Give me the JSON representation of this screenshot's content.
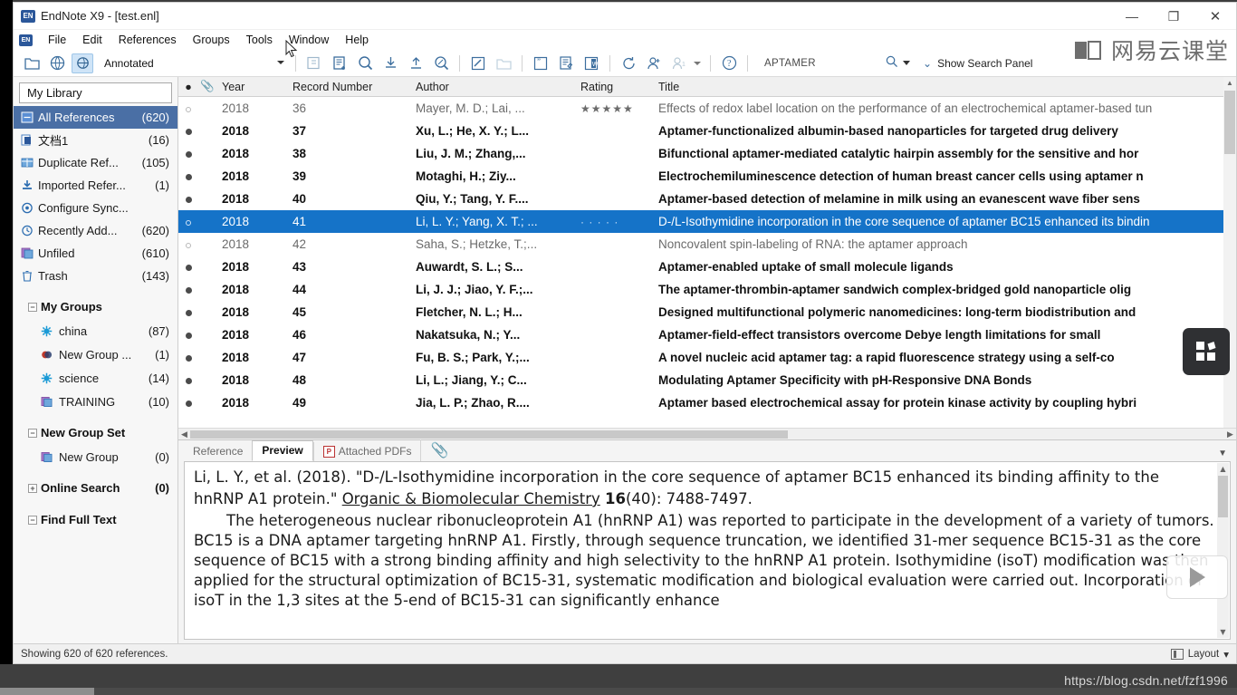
{
  "window": {
    "title": "EndNote X9 - [test.enl]",
    "app_icon": "EN",
    "minimize": "—",
    "maximize": "❐",
    "close": "✕"
  },
  "menu": {
    "items": [
      "File",
      "Edit",
      "References",
      "Groups",
      "Tools",
      "Window",
      "Help"
    ]
  },
  "toolbar": {
    "style": "Annotated",
    "icons": [
      "new-library-icon",
      "online-search-icon",
      "sync-library-icon",
      "new-reference-icon",
      "edit-reference-icon",
      "online-search-mode-icon",
      "import-icon",
      "export-icon",
      "find-full-text-icon",
      "open-pdf-icon",
      "open-file-folder-icon",
      "insert-citation-icon",
      "format-bibliography-icon",
      "word-cwyw-icon",
      "sync-icon",
      "share-library-icon",
      "activity-feed-icon",
      "help-icon"
    ],
    "search_value": "APTAMER",
    "search_placeholder": "Search",
    "show_search_panel": "Show Search Panel"
  },
  "brand": {
    "text": "网易云课堂"
  },
  "sidebar": {
    "library_label": "My Library",
    "groups": [
      {
        "icon": "all-references-icon",
        "label": "All References",
        "count": "(620)",
        "selected": true
      },
      {
        "icon": "document-group-icon",
        "label": "文档1",
        "count": "(16)",
        "selected": false
      },
      {
        "icon": "duplicate-references-icon",
        "label": "Duplicate Ref...",
        "count": "(105)",
        "selected": false
      },
      {
        "icon": "imported-references-icon",
        "label": "Imported Refer...",
        "count": "(1)",
        "selected": false
      },
      {
        "icon": "configure-sync-icon",
        "label": "Configure Sync...",
        "count": "",
        "selected": false
      },
      {
        "icon": "recently-added-icon",
        "label": "Recently Add...",
        "count": "(620)",
        "selected": false
      },
      {
        "icon": "unfiled-icon",
        "label": "Unfiled",
        "count": "(610)",
        "selected": false
      },
      {
        "icon": "trash-icon",
        "label": "Trash",
        "count": "(143)",
        "selected": false
      }
    ],
    "my_groups": {
      "title": "My Groups",
      "expander": "−",
      "items": [
        {
          "icon": "smart-group-icon",
          "label": "china",
          "count": "(87)"
        },
        {
          "icon": "combo-group-icon",
          "label": "New Group ...",
          "count": "(1)"
        },
        {
          "icon": "smart-group-icon",
          "label": "science",
          "count": "(14)"
        },
        {
          "icon": "custom-group-icon",
          "label": "TRAINING",
          "count": "(10)"
        }
      ]
    },
    "new_group_set": {
      "title": "New Group Set",
      "expander": "−",
      "items": [
        {
          "icon": "custom-group-icon",
          "label": "New Group",
          "count": "(0)"
        }
      ]
    },
    "online_search": {
      "title": "Online Search",
      "expander": "+",
      "count": "(0)"
    },
    "find_full_text": {
      "title": "Find Full Text",
      "expander": "−",
      "count": ""
    }
  },
  "table": {
    "columns": {
      "read_status": "●",
      "attachment": "📎",
      "year": "Year",
      "record_number": "Record Number",
      "author": "Author",
      "rating": "Rating",
      "title": "Title"
    },
    "rows": [
      {
        "state": "read",
        "year": "2018",
        "record": "36",
        "author": "Mayer, M. D.; Lai, ...",
        "rating": "★★★★★",
        "title": "Effects of redox label location on the performance of an electrochemical aptamer-based tun"
      },
      {
        "state": "unread",
        "year": "2018",
        "record": "37",
        "author": "Xu, L.; He, X. Y.; L...",
        "rating": "",
        "title": "Aptamer-functionalized albumin-based nanoparticles for targeted drug delivery"
      },
      {
        "state": "unread",
        "year": "2018",
        "record": "38",
        "author": "Liu, J. M.; Zhang,...",
        "rating": "",
        "title": "Bifunctional aptamer-mediated catalytic hairpin assembly for the sensitive and hor"
      },
      {
        "state": "unread",
        "year": "2018",
        "record": "39",
        "author": "Motaghi, H.; Ziy...",
        "rating": "",
        "title": "Electrochemiluminescence detection of human breast cancer cells using aptamer n"
      },
      {
        "state": "unread",
        "year": "2018",
        "record": "40",
        "author": "Qiu, Y.; Tang, Y. F....",
        "rating": "",
        "title": "Aptamer-based detection of melamine in milk using an evanescent wave fiber sens"
      },
      {
        "state": "selected",
        "year": "2018",
        "record": "41",
        "author": "Li, L. Y.; Yang, X. T.; ...",
        "rating": "· · · · ·",
        "title": "D-/L-Isothymidine incorporation in the core sequence of aptamer BC15 enhanced its bindin"
      },
      {
        "state": "read",
        "year": "2018",
        "record": "42",
        "author": "Saha, S.; Hetzke, T.;...",
        "rating": "",
        "title": "Noncovalent spin-labeling of RNA: the aptamer approach"
      },
      {
        "state": "unread",
        "year": "2018",
        "record": "43",
        "author": "Auwardt, S. L.; S...",
        "rating": "",
        "title": "Aptamer-enabled uptake of small molecule ligands"
      },
      {
        "state": "unread",
        "year": "2018",
        "record": "44",
        "author": "Li, J. J.; Jiao, Y. F.;...",
        "rating": "",
        "title": "The aptamer-thrombin-aptamer sandwich complex-bridged gold nanoparticle olig"
      },
      {
        "state": "unread",
        "year": "2018",
        "record": "45",
        "author": "Fletcher, N. L.; H...",
        "rating": "",
        "title": "Designed multifunctional polymeric nanomedicines: long-term biodistribution and"
      },
      {
        "state": "unread",
        "year": "2018",
        "record": "46",
        "author": "Nakatsuka, N.; Y...",
        "rating": "",
        "title": "Aptamer-field-effect transistors overcome Debye length limitations for small"
      },
      {
        "state": "unread",
        "year": "2018",
        "record": "47",
        "author": "Fu, B. S.; Park, Y.;...",
        "rating": "",
        "title": "A novel nucleic acid aptamer tag: a rapid fluorescence strategy using a self-co"
      },
      {
        "state": "unread",
        "year": "2018",
        "record": "48",
        "author": "Li, L.; Jiang, Y.; C...",
        "rating": "",
        "title": "Modulating Aptamer Specificity with pH-Responsive DNA Bonds"
      },
      {
        "state": "unread",
        "year": "2018",
        "record": "49",
        "author": "Jia, L. P.; Zhao, R....",
        "rating": "",
        "title": "Aptamer based electrochemical assay for protein kinase activity by coupling hybri"
      }
    ]
  },
  "preview": {
    "tabs": [
      {
        "label": "Reference",
        "active": false
      },
      {
        "label": "Preview",
        "active": true
      },
      {
        "label": "Attached PDFs",
        "active": false,
        "icon": "pdf-icon"
      }
    ],
    "clip_tab_icon": "paperclip-icon",
    "citation_line1": "Li, L. Y., et al. (2018). \"D-/L-Isothymidine incorporation in the core sequence of aptamer BC15 enhanced its binding affinity to the",
    "citation_line2_pre": "hnRNP A1 protein.\" ",
    "journal": "Organic & Biomolecular Chemistry",
    "volume": "16",
    "citation_line2_post": "(40): 7488-7497.",
    "abstract": "The heterogeneous nuclear ribonucleoprotein A1 (hnRNP A1) was reported to participate in the development of a variety of tumors. BC15 is a DNA aptamer targeting hnRNP A1. Firstly, through sequence truncation, we identified 31-mer sequence BC15-31 as the core sequence of BC15 with a strong binding affinity and high selectivity to the hnRNP A1 protein. Isothymidine (isoT) modification was then applied for the structural optimization of BC15-31, systematic modification and biological evaluation were carried out. Incorporation of isoT in the 1,3 sites at the 5-end of BC15-31 can significantly enhance"
  },
  "status": {
    "text": "Showing 620 of 620 references.",
    "layout_label": "Layout",
    "layout_caret": "▾"
  },
  "overlay": {
    "grid_icon": "app-grid-icon",
    "play_icon": "play-triangle-icon",
    "watermark": "https://blog.csdn.net/fzf1996"
  }
}
